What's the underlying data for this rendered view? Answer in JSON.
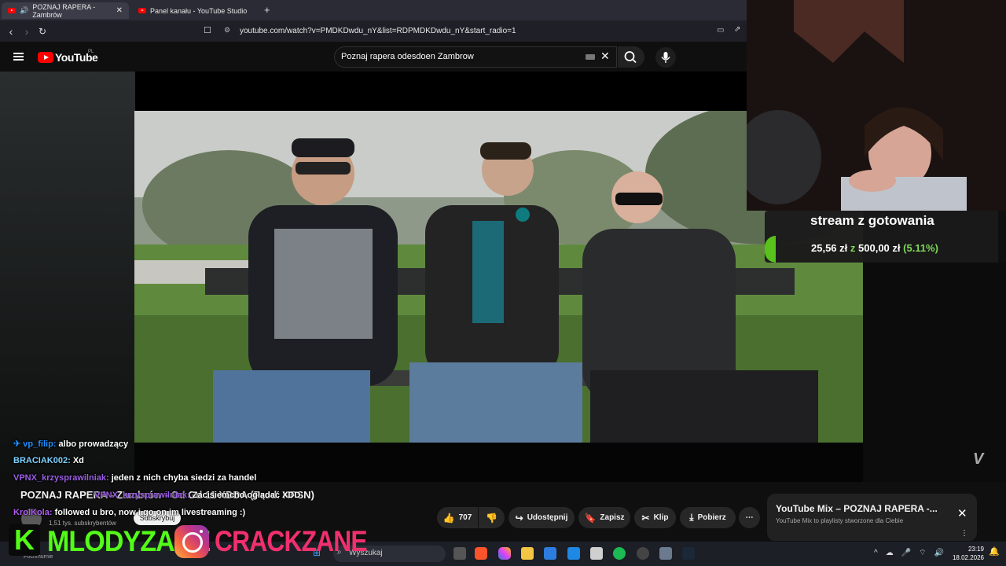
{
  "browser": {
    "tabs": [
      {
        "label": "POZNAJ RAPERA - Zambrów"
      },
      {
        "label": "Panel kanału - YouTube Studio"
      }
    ],
    "new_tab": "+",
    "url": "youtube.com/watch?v=PMDKDwdu_nY&list=RDPMDKDwdu_nY&start_radio=1"
  },
  "youtube": {
    "wordmark": "YouTube",
    "region": "PL",
    "search_value": "Poznaj rapera odesdoen Zambrow"
  },
  "video": {
    "title": "POZNAJ RAPERA - Zambrów - Od Gd 11 XDDA (Prod. KPSN)",
    "subscribers": "1,51 tys. subskrybentów",
    "subscribe_label": "Subskrybuj",
    "actions": {
      "likes": "707",
      "share": "Udostępnij",
      "save": "Zapisz",
      "clip": "Klip",
      "download": "Pobierz"
    }
  },
  "overlay": {
    "goal_title": "stream z gotowania",
    "goal_current": "25,56 zł",
    "goal_sep": "z",
    "goal_target": "500,00 zł",
    "goal_percent": "(5.11%)",
    "goal_progress": 0.0511
  },
  "chat": [
    {
      "user": "vp_filip:",
      "message": "albo prowadzący"
    },
    {
      "user": "BRACIAK002:",
      "message": "Xd"
    },
    {
      "user": "VPNX_krzysprawilniak:",
      "message": "jeden z nich chyba siedzi za handel"
    },
    {
      "user": "VPNX_krzysprawilniak:",
      "message": "Zacisiemcho oglądać XDD"
    },
    {
      "user": "KrolKola:",
      "message": "followed u bro, now i go on im livestreaming :)"
    }
  ],
  "mix": {
    "title": "YouTube Mix – POZNAJ RAPERA -...",
    "subtitle": "YouTube Mix to playlisty stworzone dla Ciebie"
  },
  "socials": {
    "kick": "MLODYZANE",
    "instagram": "CRACKZANE"
  },
  "taskbar": {
    "search_placeholder": "Wyszukaj",
    "time": "23:19",
    "date": "18.02.2026",
    "left_label": "Pochmurnie"
  }
}
